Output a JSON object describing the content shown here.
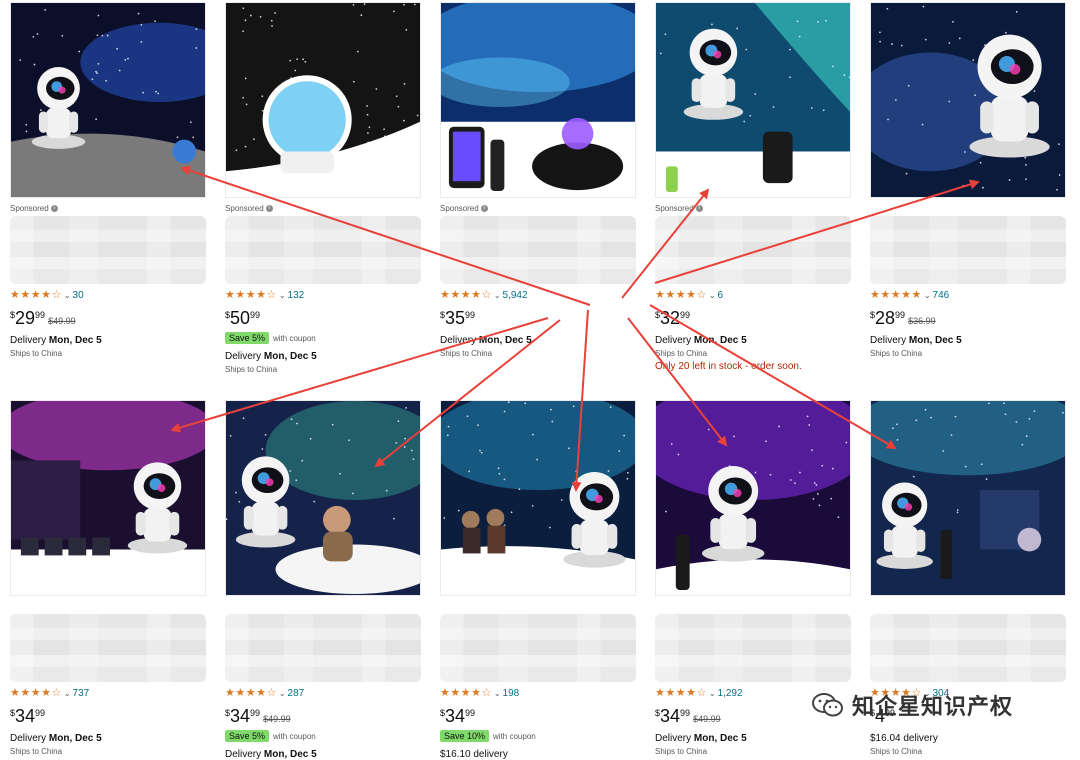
{
  "products": [
    {
      "sponsored": "Sponsored",
      "stars": "★★★★☆",
      "rating_count": "30",
      "price_symbol": "$",
      "price_whole": "29",
      "price_fraction": "99",
      "list_price": "$49.99",
      "coupon": "",
      "coupon_text": "",
      "delivery_prefix": "Delivery ",
      "delivery_date": "Mon, Dec 5",
      "ships": "Ships to China",
      "stock": "",
      "scene": "moon"
    },
    {
      "sponsored": "Sponsored",
      "stars": "★★★★☆",
      "rating_count": "132",
      "price_symbol": "$",
      "price_whole": "50",
      "price_fraction": "99",
      "list_price": "",
      "coupon": "Save 5%",
      "coupon_text": "with coupon",
      "delivery_prefix": "Delivery ",
      "delivery_date": "Mon, Dec 5",
      "ships": "Ships to China",
      "stock": "",
      "scene": "dome"
    },
    {
      "sponsored": "Sponsored",
      "stars": "★★★★☆",
      "rating_count": "5,942",
      "price_symbol": "$",
      "price_whole": "35",
      "price_fraction": "99",
      "list_price": "",
      "coupon": "",
      "coupon_text": "",
      "delivery_prefix": "Delivery ",
      "delivery_date": "Mon, Dec 5",
      "ships": "Ships to China",
      "stock": "",
      "scene": "ocean"
    },
    {
      "sponsored": "Sponsored",
      "stars": "★★★★☆",
      "rating_count": "6",
      "price_symbol": "$",
      "price_whole": "32",
      "price_fraction": "99",
      "list_price": "",
      "coupon": "",
      "coupon_text": "",
      "delivery_prefix": "Delivery ",
      "delivery_date": "Mon, Dec 5",
      "ships": "Ships to China",
      "stock": "Only 20 left in stock - order soon.",
      "scene": "aurora"
    },
    {
      "sponsored": "",
      "stars": "★★★★★",
      "rating_count": "746",
      "price_symbol": "$",
      "price_whole": "28",
      "price_fraction": "99",
      "list_price": "$36.99",
      "coupon": "",
      "coupon_text": "",
      "delivery_prefix": "Delivery ",
      "delivery_date": "Mon, Dec 5",
      "ships": "Ships to China",
      "stock": "",
      "scene": "nebula"
    },
    {
      "sponsored": "",
      "stars": "★★★★☆",
      "rating_count": "737",
      "price_symbol": "$",
      "price_whole": "34",
      "price_fraction": "99",
      "list_price": "",
      "coupon": "",
      "coupon_text": "",
      "delivery_prefix": "Delivery ",
      "delivery_date": "Mon, Dec 5",
      "ships": "Ships to China",
      "stock": "",
      "scene": "room"
    },
    {
      "sponsored": "",
      "stars": "★★★★☆",
      "rating_count": "287",
      "price_symbol": "$",
      "price_whole": "34",
      "price_fraction": "99",
      "list_price": "$49.99",
      "coupon": "Save 5%",
      "coupon_text": "with coupon",
      "delivery_prefix": "Delivery ",
      "delivery_date": "Mon, Dec 5",
      "ships": "",
      "stock": "",
      "scene": "child"
    },
    {
      "sponsored": "",
      "stars": "★★★★☆",
      "rating_count": "198",
      "price_symbol": "$",
      "price_whole": "34",
      "price_fraction": "99",
      "list_price": "",
      "coupon": "Save 10%",
      "coupon_text": "with coupon",
      "delivery_prefix": "",
      "delivery_date": "",
      "delivery_plain": "$16.10 delivery",
      "ships": "",
      "stock": "",
      "scene": "kids"
    },
    {
      "sponsored": "",
      "stars": "★★★★☆",
      "rating_count": "1,292",
      "price_symbol": "$",
      "price_whole": "34",
      "price_fraction": "99",
      "list_price": "$49.99",
      "coupon": "",
      "coupon_text": "",
      "delivery_prefix": "Delivery ",
      "delivery_date": "Mon, Dec 5",
      "ships": "Ships to China",
      "stock": "",
      "scene": "purple"
    },
    {
      "sponsored": "",
      "stars": "★★★★☆",
      "rating_count": "304",
      "price_symbol": "$",
      "price_whole": "4",
      "price_fraction": "99",
      "list_price": "",
      "coupon": "",
      "coupon_text": "",
      "delivery_prefix": "",
      "delivery_date": "",
      "delivery_plain": "$16.04 delivery",
      "ships": "Ships to China",
      "stock": "",
      "scene": "dream"
    }
  ],
  "watermark": {
    "text": "知企星知识产权",
    "icon": "wechat-icon"
  },
  "colors": {
    "star": "#de7921",
    "link": "#007185",
    "coupon": "#7fda69",
    "stock": "#b12704",
    "arrow": "#e8413a"
  }
}
